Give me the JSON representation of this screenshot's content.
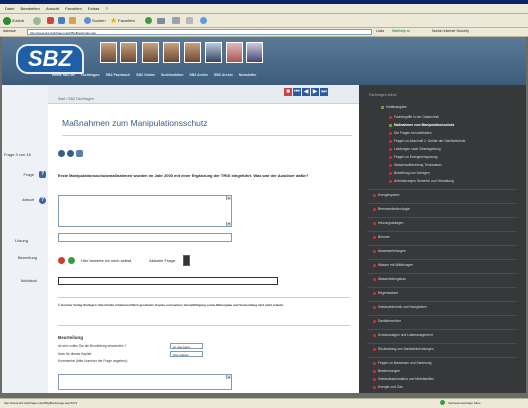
{
  "menubar": {
    "items": [
      "Datei",
      "Bearbeiten",
      "Ansicht",
      "Favoriten",
      "Extras",
      "?"
    ]
  },
  "toolbar": {
    "back_label": "Zurück",
    "search_label": "Suchen",
    "favorites_label": "Favoriten"
  },
  "address": {
    "url": "http://www.sbz-fachfragen.de/frBigBook/index.asp",
    "links_label": "Links",
    "webtool_label": "Webhelp.ru",
    "norton_label": "Norton Internet Security"
  },
  "banner": {
    "logo_text": "SBZ",
    "nav": [
      "Home SBZ.de",
      "Fachfragen",
      "SBZ Fachbuch",
      "SBZ Online",
      "Suchfunktion",
      "SBZ Archiv",
      "SBZ Archiv",
      "Newsletter"
    ]
  },
  "left": {
    "page_label": "Frage 3 von 16",
    "frage_label": "Frage",
    "antwort_label": "Antwort",
    "loesung_label": "Lösung",
    "bewertung_label": "Bewertung",
    "notizen_label": "Notizblock"
  },
  "main": {
    "breadcrumb": "Start / SBZ Fachfragen",
    "title": "Maßnahmen zum Manipulationsschutz",
    "question": "Erste Manipulationsschutzmaßnahmen wurden im Jahr 2000 mit einer Ergänzung der TRGI eingeführt. Was war der Auslöser dafür?",
    "eval_text": "Hier bewerte ich mich selbst.",
    "active_label": "Aktuelle Frage:",
    "copyright": "© Gentner Verlag Stuttgart / Alle Inhalte urheberrechtlich geschützt. Kopien und weitere Vervielfältigung sowie Weitergabe und Verwendung sind nicht erlaubt.",
    "rating_heading": "Beurteilung",
    "rating_q1": "Ist sein vollen Sie die Beurteilung verwenden ?",
    "rating_q1_value": "an das Kana",
    "rating_q2": "Note für dieses Kapitel:",
    "rating_q2_value": "bitte wählen",
    "rating_q3": "Kommentar (bitte Nummer der Frage angeben):"
  },
  "rightpanel": {
    "title": "Fachfragen-Menü",
    "items": [
      "Inhaltsangabe",
      "Fachbegriffe in der Gastechnik",
      "Maßnahmen zum Manipulationsschutz",
      "Die Fragen herunterladen",
      "Fragen zu Abschnitt 1: Geräte der Sanitärtechnik",
      "Leistungen nach Gesetzgebung",
      "Fragen zu Energieeinsparung",
      "Wasseraufbereitung Trinkwasser",
      "Bestellung von Vorlagen",
      "Anforderungen Gewerbe und Verwaltung",
      "Energiesparen",
      "Brennwerttechnologie",
      "Heizungsanlagen",
      "Brenner",
      "Abwasserleitungen",
      "Wasser mit Mitteilungen",
      "Wasserleitungsbau",
      "Regenwasser",
      "Gebäudetechnik und Neuigkeiten",
      "Sanitärbereiche",
      "Schutzanlagen und Lastmanagement",
      "Rückhaltung von Sanitäreinrichtungen",
      "Fragen zu Bauwesen und Sanierung",
      "Bestimmungen",
      "Gebäudeautomation und Mehrfamilien",
      "Energie und Gas",
      "Solar-Technik",
      "Gerätekatalog"
    ]
  },
  "status": {
    "url": "http://www.sbz-fachfragen.de/frBigBook/page.asp?id=3",
    "zone_label": "Vertrauenswürdige Sites"
  }
}
